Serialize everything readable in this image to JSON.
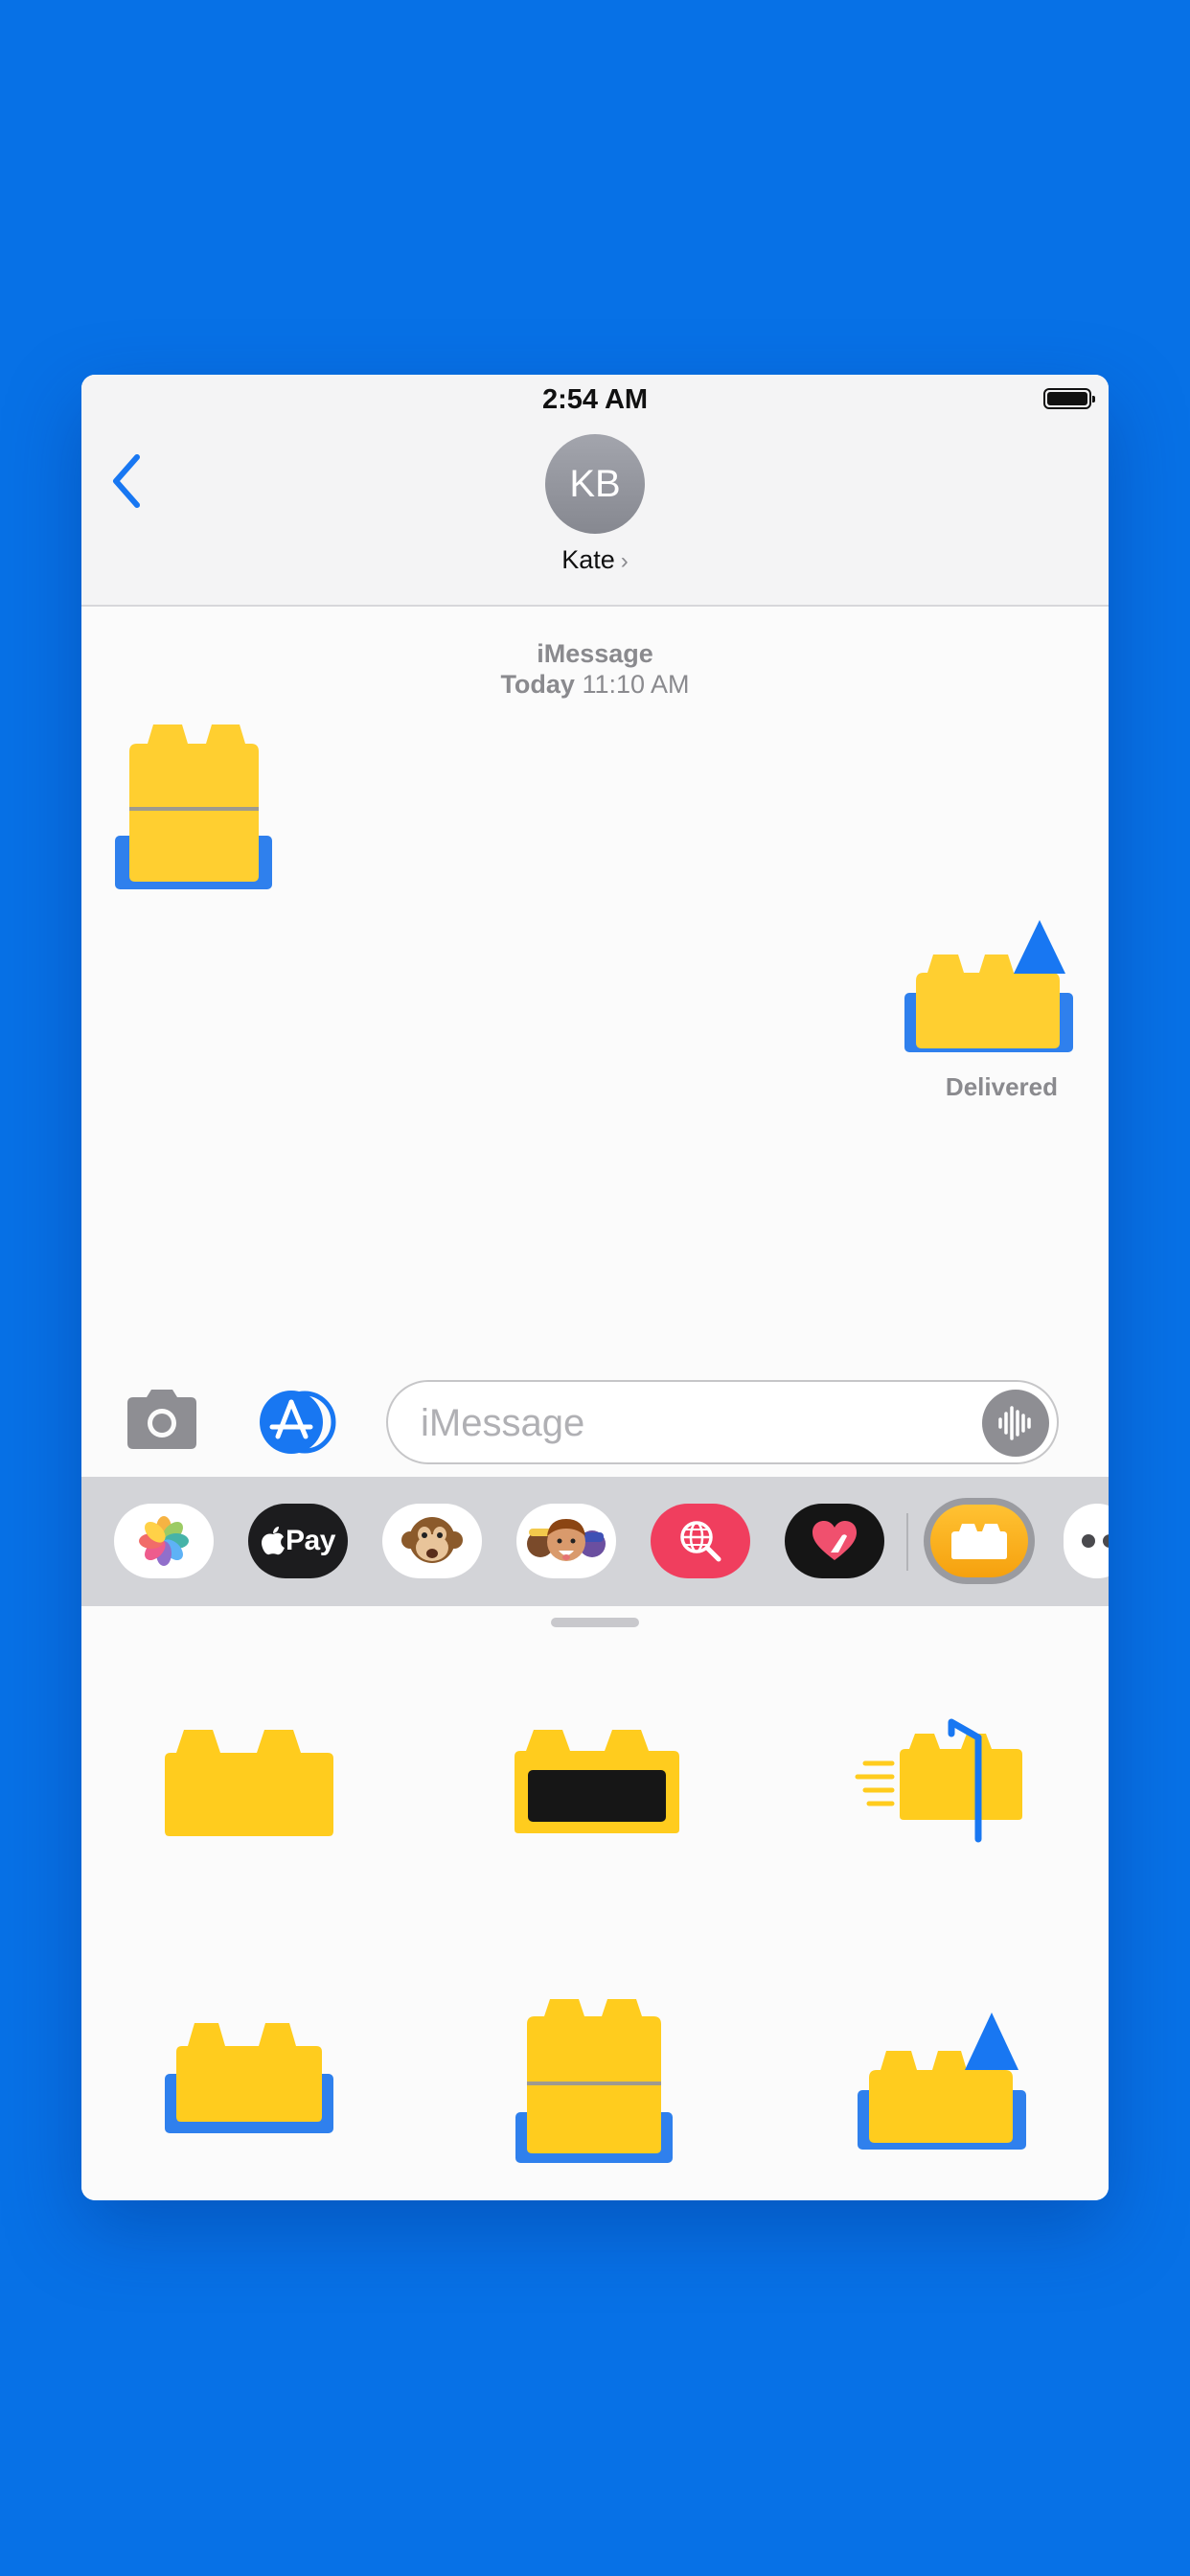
{
  "status_bar": {
    "time": "2:54 AM"
  },
  "header": {
    "avatar_initials": "KB",
    "contact_name": "Kate",
    "chevron": "›"
  },
  "thread": {
    "service": "iMessage",
    "day": "Today",
    "time": "11:10 AM",
    "status": "Delivered"
  },
  "input": {
    "placeholder": "iMessage"
  },
  "drawer": {
    "apps": [
      {
        "name": "photos",
        "icon": "photos-icon"
      },
      {
        "name": "apple-pay",
        "label": "Pay",
        "icon": "apple-logo-icon"
      },
      {
        "name": "animoji",
        "icon": "monkey-icon"
      },
      {
        "name": "memoji",
        "icon": "memoji-icon"
      },
      {
        "name": "web-images",
        "icon": "globe-search-icon"
      },
      {
        "name": "digital-touch",
        "icon": "heart-touch-icon"
      },
      {
        "name": "bricks-stickers",
        "icon": "brick-icon",
        "selected": true
      },
      {
        "name": "more",
        "icon": "more-icon"
      }
    ]
  },
  "stickers": [
    "brick-plain",
    "brick-screen",
    "brick-mailbox",
    "brick-tray",
    "brick-tall-tray",
    "brick-tray-triangle"
  ],
  "colors": {
    "background": "#0771E6",
    "accent": "#1877F2",
    "brick": "#FFCC22",
    "bubble_blue": "#2F80ED"
  }
}
